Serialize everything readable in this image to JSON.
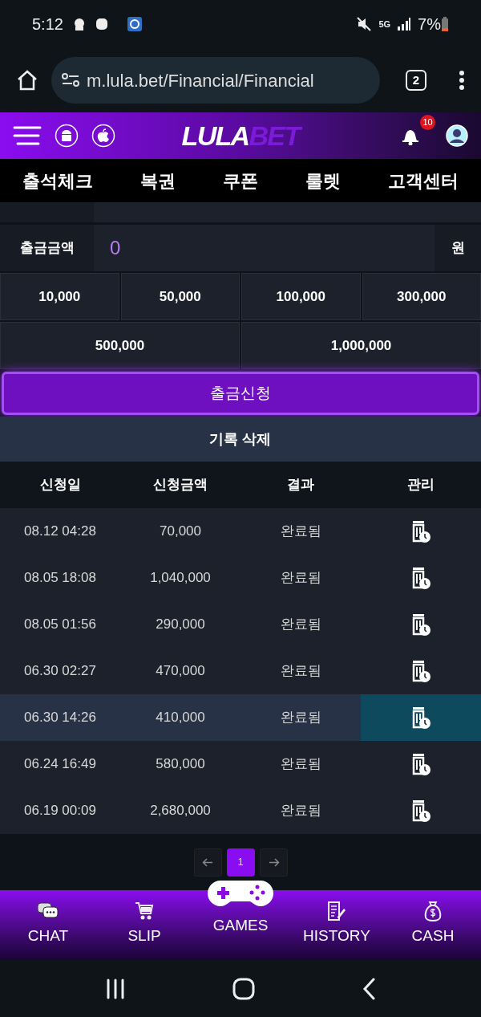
{
  "status_bar": {
    "time": "5:12",
    "network": "5G",
    "battery": "7%"
  },
  "browser": {
    "url": "m.lula.bet/Financial/Financial",
    "tab_count": "2"
  },
  "header": {
    "logo": {
      "main": "LULA",
      "accent": "BET"
    },
    "notification_count": "10"
  },
  "nav_menu": [
    "출석체크",
    "복권",
    "쿠폰",
    "룰렛",
    "고객센터"
  ],
  "amount_field": {
    "label": "출금금액",
    "value": "0",
    "unit": "원"
  },
  "quick_amounts": [
    [
      "10,000",
      "50,000",
      "100,000",
      "300,000"
    ],
    [
      "500,000",
      "1,000,000"
    ]
  ],
  "submit_button": "출금신청",
  "delete_history_button": "기록 삭제",
  "table": {
    "columns": [
      "신청일",
      "신청금액",
      "결과",
      "관리"
    ],
    "rows": [
      {
        "date": "08.12 04:28",
        "amount": "70,000",
        "result": "완료됨",
        "highlighted": false
      },
      {
        "date": "08.05 18:08",
        "amount": "1,040,000",
        "result": "완료됨",
        "highlighted": false
      },
      {
        "date": "08.05 01:56",
        "amount": "290,000",
        "result": "완료됨",
        "highlighted": false
      },
      {
        "date": "06.30 02:27",
        "amount": "470,000",
        "result": "완료됨",
        "highlighted": false
      },
      {
        "date": "06.30 14:26",
        "amount": "410,000",
        "result": "완료됨",
        "highlighted": true
      },
      {
        "date": "06.24 16:49",
        "amount": "580,000",
        "result": "완료됨",
        "highlighted": false
      },
      {
        "date": "06.19 00:09",
        "amount": "2,680,000",
        "result": "완료됨",
        "highlighted": false
      }
    ]
  },
  "pagination": {
    "pages": [
      {
        "label": "1",
        "selected": true
      }
    ]
  },
  "bottom_nav": [
    {
      "kind": "chat",
      "label": "CHAT"
    },
    {
      "kind": "slip",
      "label": "SLIP"
    },
    {
      "kind": "games",
      "label": "GAMES"
    },
    {
      "kind": "history",
      "label": "HISTORY"
    },
    {
      "kind": "cash",
      "label": "CASH"
    }
  ]
}
